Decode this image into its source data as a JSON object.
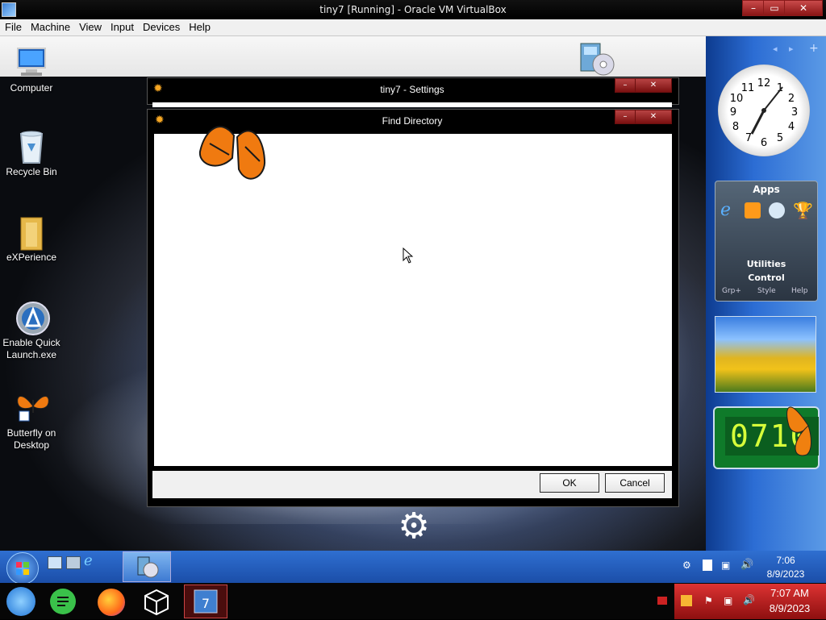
{
  "host_window": {
    "title": "tiny7 [Running] - Oracle VM VirtualBox",
    "menu": [
      "File",
      "Machine",
      "View",
      "Input",
      "Devices",
      "Help"
    ]
  },
  "desktop": {
    "icons": [
      {
        "name": "computer-icon",
        "label": "Computer"
      },
      {
        "name": "recycle-bin-icon",
        "label": "Recycle Bin"
      },
      {
        "name": "folder-icon",
        "label": "eXPerience"
      },
      {
        "name": "quick-launch-icon",
        "label_line1": "Enable Quick",
        "label_line2": "Launch.exe"
      },
      {
        "name": "butterfly-icon",
        "label_line1": "Butterfly on",
        "label_line2": "Desktop"
      }
    ]
  },
  "gadgets": {
    "clock_numbers": [
      "12",
      "1",
      "2",
      "3",
      "4",
      "5",
      "6",
      "7",
      "8",
      "9",
      "10",
      "11"
    ],
    "apps": {
      "title": "Apps",
      "utilities": "Utilities",
      "control": "Control",
      "grp": "Grp+",
      "style": "Style",
      "help": "Help"
    },
    "digital_clock": "0710"
  },
  "settings_dialog": {
    "title": "tiny7 - Settings"
  },
  "find_dialog": {
    "title": "Find Directory",
    "ok_label": "OK",
    "cancel_label": "Cancel"
  },
  "guest_taskbar": {
    "time": "7:06",
    "date": "8/9/2023"
  },
  "host_taskbar": {
    "time": "7:07 AM",
    "date": "8/9/2023"
  }
}
